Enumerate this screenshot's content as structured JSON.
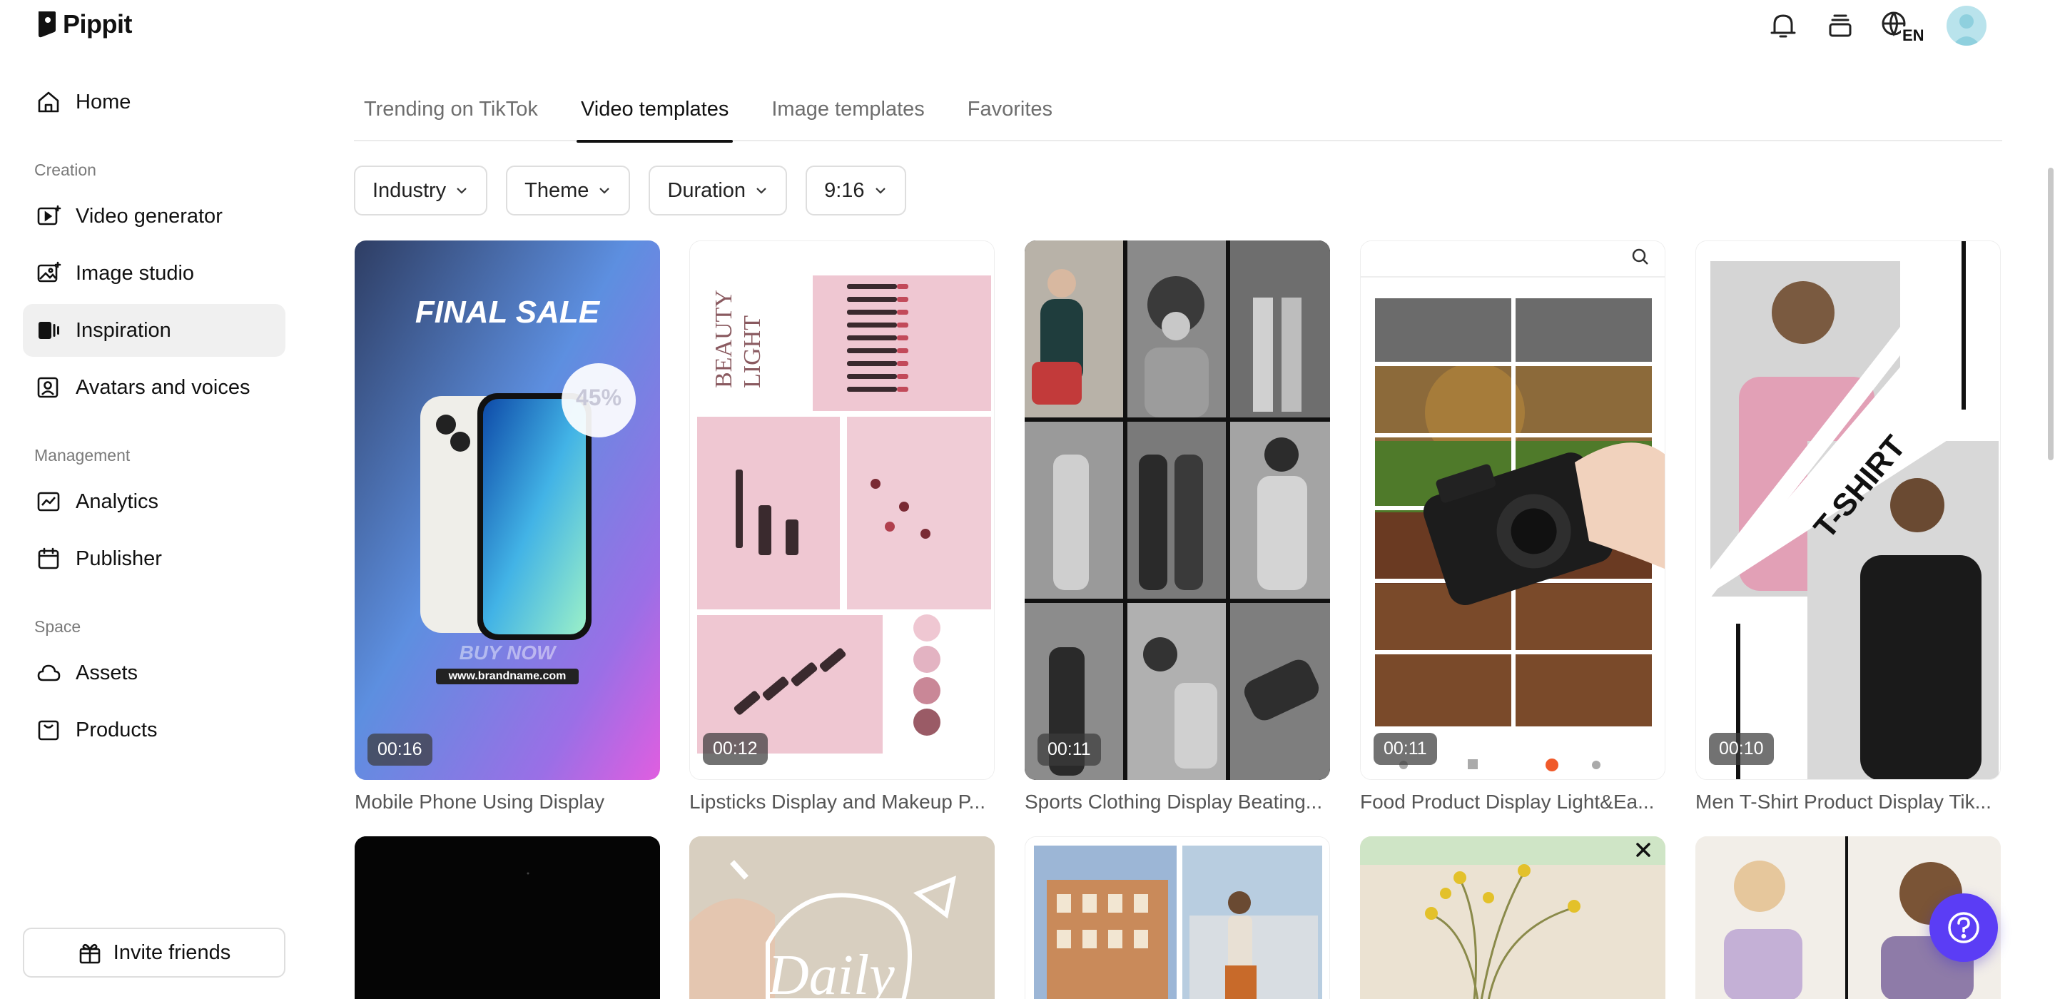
{
  "app": {
    "name": "Pippit"
  },
  "sidebar": {
    "home": "Home",
    "sections": {
      "creation": "Creation",
      "management": "Management",
      "space": "Space"
    },
    "items": {
      "video_generator": "Video generator",
      "image_studio": "Image studio",
      "inspiration": "Inspiration",
      "avatars_voices": "Avatars and voices",
      "analytics": "Analytics",
      "publisher": "Publisher",
      "assets": "Assets",
      "products": "Products"
    },
    "active": "Inspiration",
    "invite_label": "Invite friends"
  },
  "header": {
    "language": "EN",
    "icons": [
      "bell-icon",
      "layers-icon",
      "globe-icon",
      "avatar"
    ]
  },
  "tabs": [
    {
      "label": "Trending on TikTok",
      "active": false
    },
    {
      "label": "Video templates",
      "active": true
    },
    {
      "label": "Image templates",
      "active": false
    },
    {
      "label": "Favorites",
      "active": false
    }
  ],
  "filters": [
    {
      "label": "Industry"
    },
    {
      "label": "Theme"
    },
    {
      "label": "Duration"
    },
    {
      "label": "9:16"
    }
  ],
  "templates": [
    {
      "title": "Mobile Phone Using Display",
      "duration": "00:16",
      "overlay": {
        "headline": "FINAL SALE",
        "badge": "45%",
        "cta": "BUY NOW",
        "url": "www.brandname.com"
      }
    },
    {
      "title": "Lipsticks Display and Makeup P...",
      "duration": "00:12",
      "overlay": {
        "headline": "BEAUTY LIGHT"
      }
    },
    {
      "title": "Sports Clothing Display Beating...",
      "duration": "00:11"
    },
    {
      "title": "Food Product Display Light&Ea...",
      "duration": "00:11"
    },
    {
      "title": "Men T-Shirt Product Display Tik...",
      "duration": "00:10",
      "overlay": {
        "headline": "T-SHIRT"
      }
    }
  ],
  "second_row": {
    "daily_text": "Daily"
  },
  "colors": {
    "accent": "#5b3df5",
    "active_tab_underline": "#111111",
    "nav_active_bg": "#f0f0f0"
  }
}
